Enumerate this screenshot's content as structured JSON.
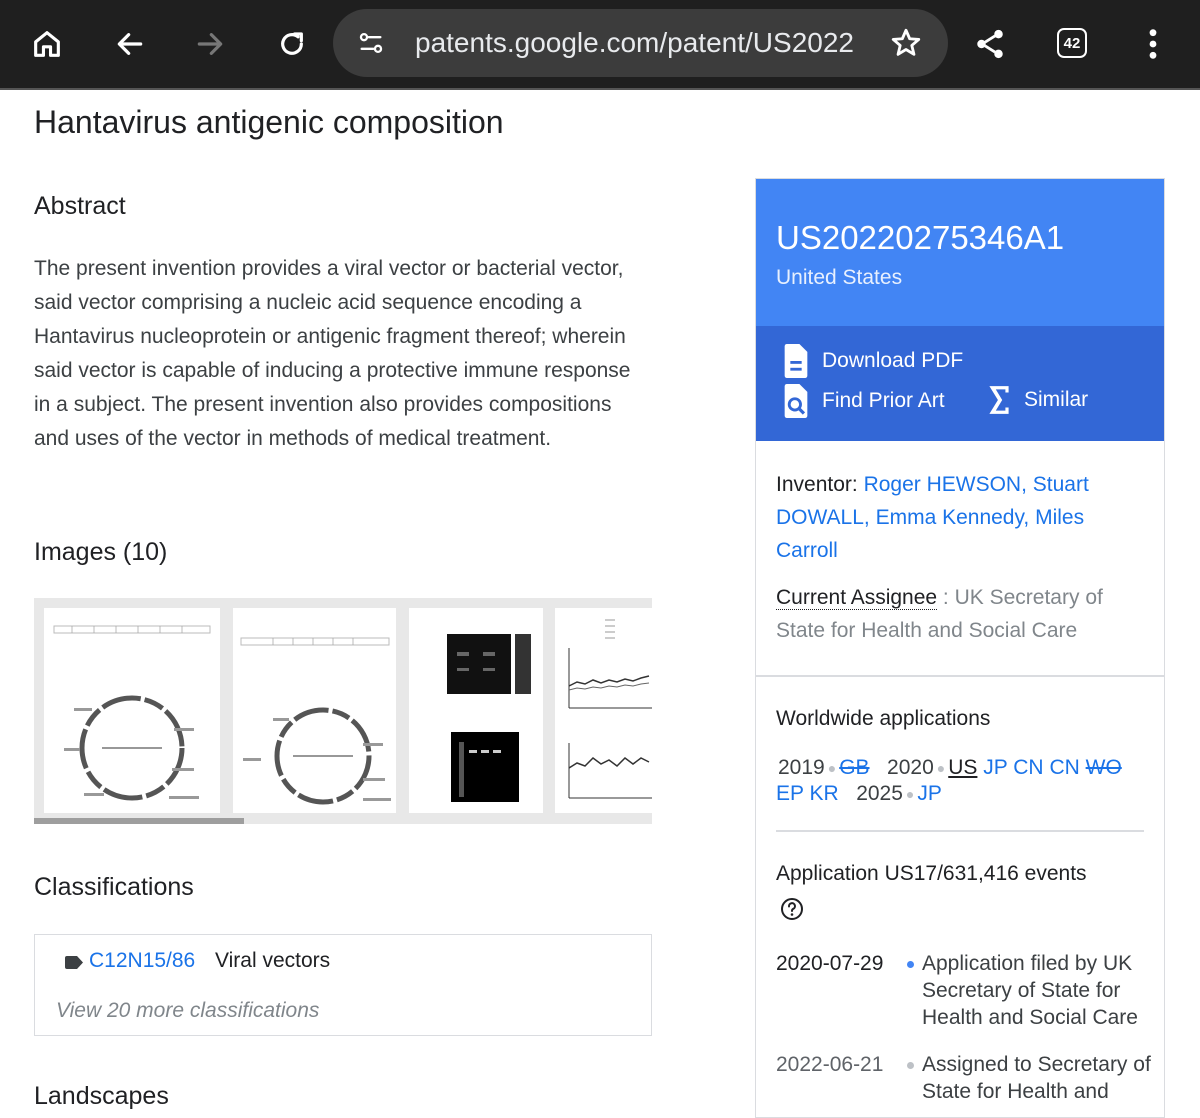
{
  "browser": {
    "url": "patents.google.com/patent/US2022",
    "tab_count": "42",
    "icons": [
      "home-icon",
      "back-icon",
      "forward-icon",
      "reload-icon",
      "site-settings-icon",
      "bookmark-star-icon",
      "share-icon",
      "tab-switcher-icon",
      "more-menu-icon"
    ]
  },
  "page": {
    "title": "Hantavirus antigenic composition",
    "abstract_heading": "Abstract",
    "abstract_text": "The present invention provides a viral vector or bacterial vector, said vector comprising a nucleic acid sequence encoding a Hantavirus nucleoprotein or antigenic fragment thereof; wherein said vector is capable of inducing a protective immune response in a subject. The present invention also provides compositions and uses of the vector in methods of medical treatment.",
    "images_heading": "Images (10)",
    "classifications_heading": "Classifications",
    "classification": {
      "code": "C12N15/86",
      "desc": "Viral vectors",
      "more": "View 20 more classifications"
    },
    "landscapes_heading": "Landscapes"
  },
  "panel": {
    "pub_number": "US20220275346A1",
    "country": "United States",
    "actions": {
      "download_pdf": "Download PDF",
      "find_prior_art": "Find Prior Art",
      "similar": "Similar"
    },
    "inventor_label": "Inventor:",
    "inventors": "Roger HEWSON, Stuart DOWALL, Emma Kennedy, Miles Carroll",
    "assignee_label": "Current Assignee",
    "assignee_sep": " : ",
    "assignee": "UK Secretary of State for Health and Social Care",
    "worldwide_title": "Worldwide applications",
    "worldwide": {
      "y2019": "2019",
      "y2019_gb": "GB",
      "y2020": "2020",
      "us": "US",
      "jp": "JP",
      "cn1": "CN",
      "cn2": "CN",
      "wo": "WO",
      "ep": "EP",
      "kr": "KR",
      "y2025": "2025",
      "jp2": "JP"
    },
    "events_title": "Application US17/631,416 events",
    "events": [
      {
        "date": "2020-07-29",
        "text": "Application filed by UK Secretary of State for Health and Social Care"
      },
      {
        "date": "2022-06-21",
        "text": "Assigned to Secretary of State for Health and"
      }
    ],
    "colors": {
      "header": "#4285f4",
      "actions": "#3367d6",
      "link": "#1a73e8"
    }
  }
}
